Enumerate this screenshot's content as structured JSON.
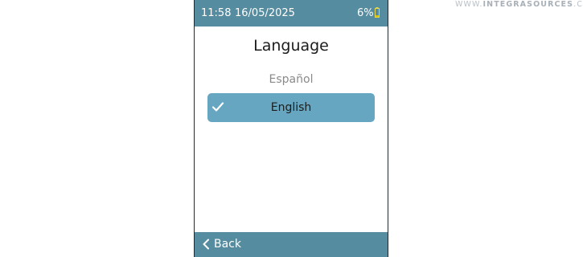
{
  "watermark": {
    "prefix": "WWW.",
    "brand": "INTEGRASOURCES",
    "suffix": ".COM"
  },
  "status_bar": {
    "time": "11:58",
    "date": "16/05/2025",
    "battery_percent": "6%",
    "battery_icon": "battery-low-icon",
    "battery_level": 0.06
  },
  "screen": {
    "title": "Language",
    "options": [
      {
        "label": "Español",
        "selected": false
      },
      {
        "label": "English",
        "selected": true
      }
    ],
    "selected_icon": "check-icon"
  },
  "bottom_bar": {
    "back_label": "Back",
    "back_icon": "chevron-left-icon"
  },
  "colors": {
    "bar_bg": "#558c9f",
    "selected_bg": "#66a6c0",
    "inactive_text": "#8a8a8a",
    "battery_fill": "#d6c400"
  }
}
